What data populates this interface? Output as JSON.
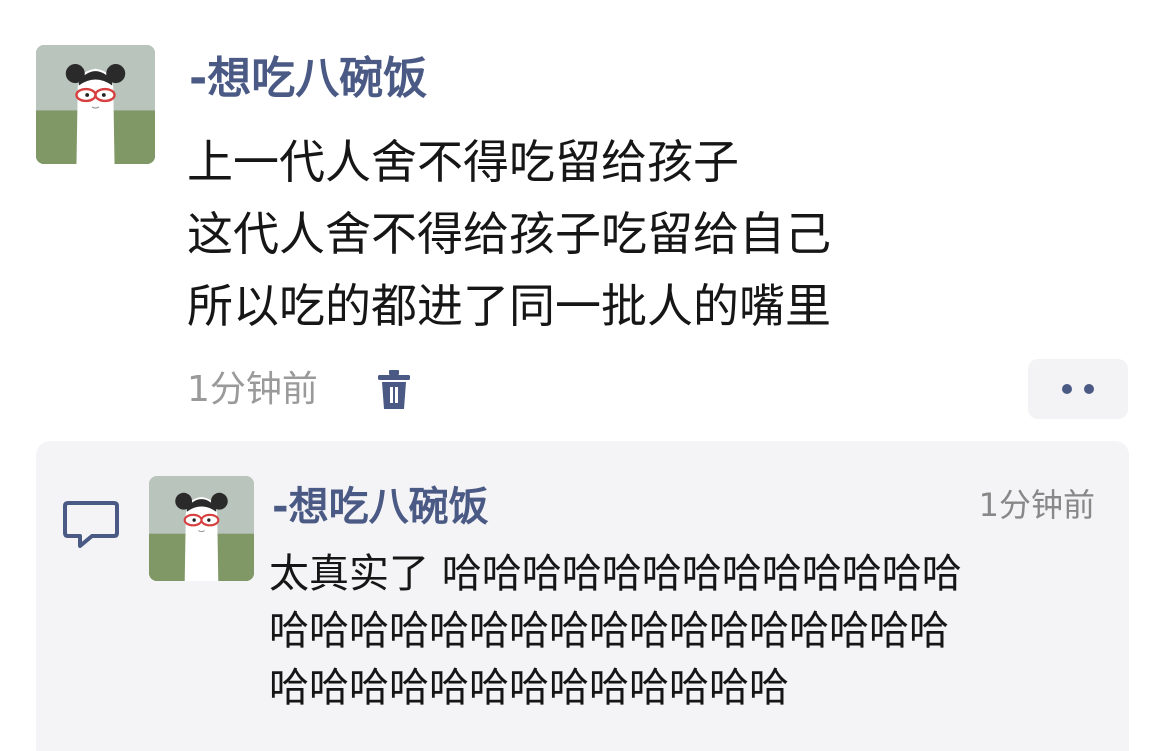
{
  "post": {
    "author": "-想吃八碗饭",
    "lines": [
      "上一代人舍不得吃留给孩子",
      "这代人舍不得给孩子吃留给自己",
      "所以吃的都进了同一批人的嘴里"
    ],
    "time": "1分钟前"
  },
  "reply": {
    "author": "-想吃八碗饭",
    "time": "1分钟前",
    "lines": [
      "太真实了 哈哈哈哈哈哈哈哈哈哈哈哈哈",
      "哈哈哈哈哈哈哈哈哈哈哈哈哈哈哈哈哈",
      "哈哈哈哈哈哈哈哈哈哈哈哈哈"
    ]
  },
  "icons": {
    "delete": "trash-icon",
    "more": "more-dots-icon",
    "reply": "comment-bubble-icon"
  },
  "colors": {
    "username": "#4a5a85",
    "meta": "#9a9a9a",
    "text": "#161616",
    "reply_background": "#f4f4f6"
  }
}
